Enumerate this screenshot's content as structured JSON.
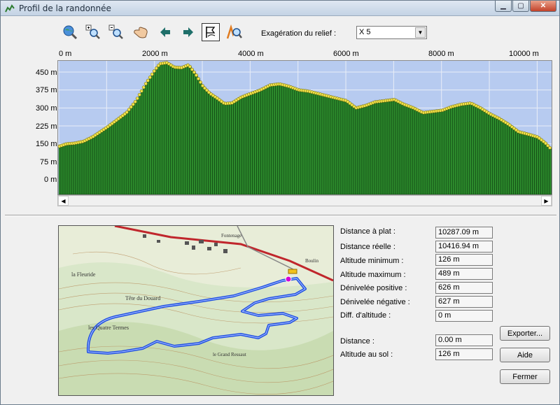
{
  "window": {
    "title": "Profil de la randonnée"
  },
  "toolbar": {
    "relief_label": "Exagération du relief :",
    "relief_value": "X 5",
    "buttons": [
      "zoom-global",
      "zoom-in",
      "zoom-out",
      "pan",
      "previous",
      "next",
      "select-profile",
      "map-locate"
    ]
  },
  "chart_data": {
    "type": "area",
    "title": "",
    "xlabel": "",
    "ylabel": "",
    "x_unit": "m",
    "x_ticks": [
      "0 m",
      "2000 m",
      "4000 m",
      "6000 m",
      "8000 m",
      "10000 m"
    ],
    "y_ticks": [
      "450 m",
      "375 m",
      "300 m",
      "225 m",
      "150 m",
      "75 m",
      "0 m"
    ],
    "xlim": [
      0,
      10287
    ],
    "ylim": [
      0,
      489
    ],
    "series": [
      {
        "x": [
          0,
          150,
          300,
          500,
          700,
          850,
          1000,
          1200,
          1400,
          1600,
          1800,
          2000,
          2100,
          2250,
          2400,
          2550,
          2700,
          2850,
          3000,
          3150,
          3300,
          3450,
          3600,
          3800,
          4000,
          4200,
          4400,
          4600,
          4800,
          5000,
          5200,
          5400,
          5600,
          5800,
          6000,
          6200,
          6400,
          6600,
          6800,
          7000,
          7200,
          7400,
          7600,
          7800,
          8000,
          8200,
          8400,
          8600,
          8800,
          9000,
          9200,
          9400,
          9600,
          9800,
          10000,
          10150,
          10287
        ],
        "values": [
          140,
          150,
          152,
          160,
          180,
          200,
          220,
          250,
          280,
          330,
          400,
          460,
          485,
          489,
          470,
          468,
          480,
          440,
          390,
          360,
          340,
          318,
          320,
          345,
          360,
          375,
          395,
          400,
          390,
          375,
          370,
          360,
          350,
          340,
          330,
          300,
          310,
          325,
          330,
          335,
          315,
          300,
          280,
          285,
          290,
          305,
          315,
          320,
          300,
          275,
          255,
          230,
          200,
          190,
          178,
          155,
          126
        ]
      }
    ],
    "grid": true,
    "area_color": "#2c8a2c",
    "point_color": "#f0e24a",
    "plot_background": "#b7cbf0"
  },
  "stats": [
    {
      "label": "Distance à plat :",
      "value": "10287.09 m"
    },
    {
      "label": "Distance réelle :",
      "value": "10416.94 m"
    },
    {
      "label": "Altitude minimum :",
      "value": "126 m"
    },
    {
      "label": "Altitude maximum :",
      "value": "489 m"
    },
    {
      "label": "Dénivelée positive :",
      "value": "626 m"
    },
    {
      "label": "Dénivelée négative :",
      "value": "627 m"
    },
    {
      "label": "Diff. d'altitude :",
      "value": "0 m"
    },
    {
      "label": "Distance :",
      "value": "0.00 m"
    },
    {
      "label": "Altitude au sol :",
      "value": "126 m"
    }
  ],
  "buttons": {
    "export": "Exporter...",
    "help": "Aide",
    "close": "Fermer"
  },
  "map": {
    "labels": [
      "Tête du Douard",
      "les Quatre Termes",
      "la Fleuride",
      "le Grand Ressaut",
      "Fontenage",
      "Boulin"
    ],
    "route_color": "#1f4fe0"
  }
}
